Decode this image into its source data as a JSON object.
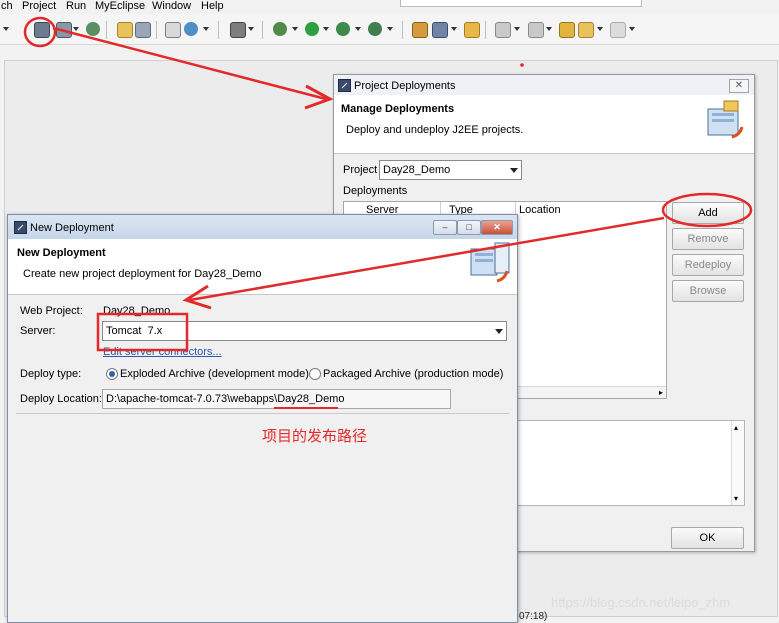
{
  "menubar": {
    "items": [
      "ch",
      "Project",
      "Run",
      "MyEclipse",
      "Window",
      "Help"
    ]
  },
  "toolbar": {
    "icons": [
      "deploy-icon",
      "server-icon",
      "globe-icon",
      "folder-icon",
      "package-icon",
      "new-icon",
      "browser-icon",
      "console-icon",
      "bug-icon",
      "run-icon",
      "coverage-icon",
      "external-tools-icon",
      "open-type-icon",
      "pen-icon",
      "folder-open-icon",
      "annotation-icon",
      "back-icon",
      "forward-icon"
    ]
  },
  "project_deployments": {
    "title": "Project Deployments",
    "heading": "Manage Deployments",
    "description": "Deploy and undeploy J2EE projects.",
    "project_label": "Project",
    "project_value": "Day28_Demo",
    "deployments_label": "Deployments",
    "columns": [
      "Server",
      "Type",
      "Location"
    ],
    "buttons": {
      "add": "Add",
      "remove": "Remove",
      "redeploy": "Redeploy",
      "browse": "Browse",
      "ok": "OK"
    }
  },
  "new_deployment": {
    "title": "New Deployment",
    "heading": "New Deployment",
    "description": "Create new project deployment for Day28_Demo",
    "web_project_label": "Web Project:",
    "web_project_value": "Day28_Demo",
    "server_label": "Server:",
    "server_value": "Tomcat  7.x",
    "edit_link": "Edit server connectors...",
    "deploy_type_label": "Deploy type:",
    "deploy_type_exploded": "Exploded Archive (development mode)",
    "deploy_type_packaged": "Packaged Archive (production mode)",
    "deploy_location_label": "Deploy Location:",
    "deploy_location_value": "D:\\apache-tomcat-7.0.73\\webapps\\Day28_Demo"
  },
  "annotation": {
    "note": "项目的发布路径",
    "color": "#e32a2a"
  },
  "status_fragment": "07:18)",
  "watermark": "https://blog.csdn.net/leipo_zhm"
}
